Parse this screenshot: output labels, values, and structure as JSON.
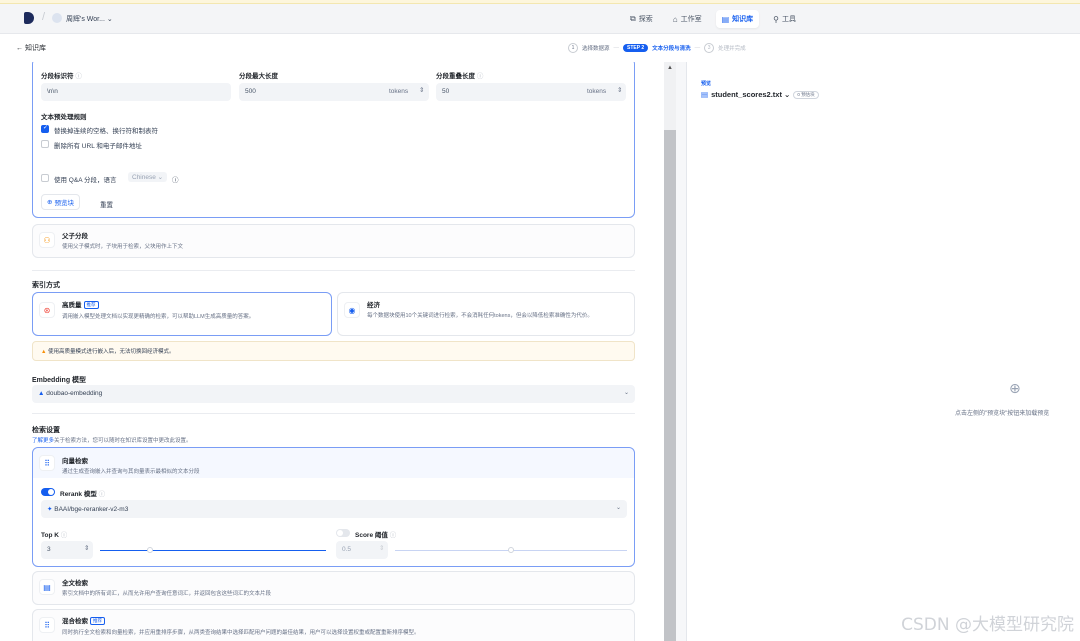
{
  "topnav": {
    "workspace": "周辉's Wor... ⌄",
    "links": [
      {
        "icon": "compass-icon",
        "glyph": "⧉",
        "label": "探索"
      },
      {
        "icon": "studio-icon",
        "glyph": "⌂",
        "label": "工作室"
      },
      {
        "icon": "book-icon",
        "glyph": "▤",
        "label": "知识库"
      },
      {
        "icon": "tools-icon",
        "glyph": "⚲",
        "label": "工具"
      }
    ]
  },
  "subhead": {
    "back_label": "← 知识库",
    "step1_num": "1",
    "step1_label": "选择数据源",
    "step2_badge": "STEP 2",
    "step2_label": "文本分段与清洗",
    "step3_num": "3",
    "step3_label": "处理并完成"
  },
  "segment": {
    "delimiter_label": "分段标识符",
    "delimiter_value": "\\n\\n",
    "maxlen_label": "分段最大长度",
    "maxlen_value": "500",
    "maxlen_unit": "tokens",
    "overlap_label": "分段重叠长度",
    "overlap_value": "50",
    "overlap_unit": "tokens",
    "preprocess_label": "文本预处理规则",
    "rule1": "替换掉连续的空格、换行符和制表符",
    "rule2": "删除所有 URL 和电子邮件地址",
    "qa_label": "使用 Q&A 分段，语言",
    "qa_lang": "Chinese ⌄",
    "preview_btn": "预览块",
    "reset_btn": "重置"
  },
  "parent_child": {
    "title": "父子分段",
    "desc": "使用父子模式时，子块用于检索，父块用作上下文"
  },
  "index": {
    "section": "索引方式",
    "hq_title": "高质量",
    "hq_tag": "推荐",
    "hq_desc": "调用嵌入模型处理文档以实现更精确的检索，可以帮助LLM生成高质量的答案。",
    "eco_title": "经济",
    "eco_desc": "每个数据块使用10个关键词进行检索，不会消耗任何tokens，但会以降低检索准确性为代价。",
    "warning": "使用高质量模式进行嵌入后，无法切换回经济模式。"
  },
  "embedding": {
    "label": "Embedding 模型",
    "model": "doubao-embedding"
  },
  "retrieval": {
    "section": "检索设置",
    "learn_more": "了解更多",
    "desc": "关于检索方法，您可以随时在知识库设置中更改此设置。",
    "vector_title": "向量检索",
    "vector_desc": "通过生成查询嵌入并查询与其向量表示最相似的文本分段",
    "rerank_label": "Rerank 模型",
    "rerank_model": "BAAI/bge-reranker-v2-m3",
    "topk_label": "Top K",
    "topk_value": "3",
    "score_label": "Score 阈值",
    "score_value": "0.5",
    "topk_slider_fraction": 0.22,
    "score_slider_fraction": 0.5,
    "fulltext_title": "全文检索",
    "fulltext_desc": "索引文档中的所有词汇，从而允许用户查询任意词汇，并返回包含这些词汇的文本片段",
    "hybrid_title": "混合检索",
    "hybrid_tag": "推荐",
    "hybrid_desc": "同时执行全文检索和向量检索，并应用重排序步骤，从两类查询结果中选择匹配用户问题的最佳结果，用户可以选择设置权重或配置重新排序模型。"
  },
  "preview": {
    "label": "预览",
    "file": "student_scores2.txt ⌄",
    "badge": "0 预估块",
    "empty": "点击左侧的\"预览块\"按钮来加载预览"
  },
  "watermark": "CSDN @大模型研究院",
  "colors": {
    "accent": "#155eef",
    "warning": "#f79009"
  }
}
